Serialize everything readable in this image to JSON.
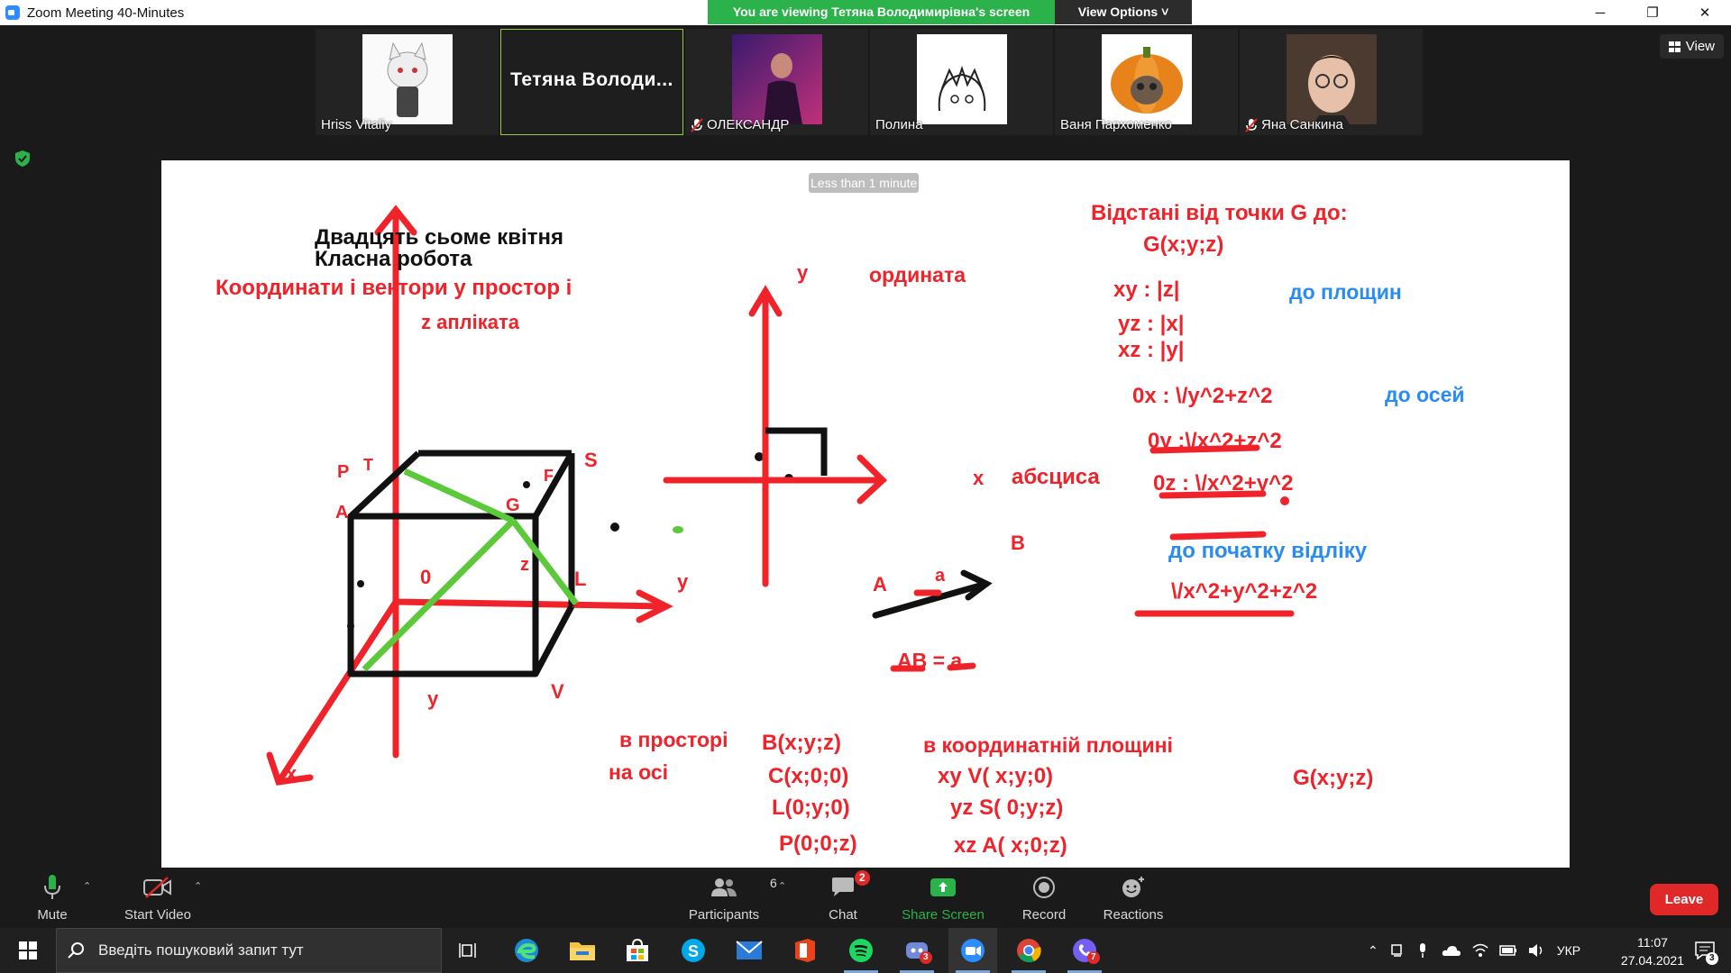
{
  "window": {
    "title": "Zoom Meeting 40-Minutes",
    "minimize_label": "─",
    "restore_label": "❐",
    "close_label": "✕"
  },
  "share_banner": {
    "message": "You are viewing Тетяна Володимирівна's screen",
    "view_options": "View Options ˅"
  },
  "gallery": {
    "participants": [
      {
        "name": "Hriss Vitaliy",
        "muted": false,
        "avatar": "white-cat-character"
      },
      {
        "name": "Тетяна  Володи...",
        "muted": false,
        "active": true
      },
      {
        "name": "ОЛЕКСАНДР",
        "muted": true,
        "avatar": "singer-photo"
      },
      {
        "name": "Полина",
        "muted": false,
        "avatar": "anime-sketch"
      },
      {
        "name": "Ваня Пархоменко",
        "muted": false,
        "avatar": "pumpkin-cat"
      },
      {
        "name": "Яна Санкина",
        "muted": true,
        "avatar": "boy-with-glasses"
      }
    ],
    "view_button": "View"
  },
  "whiteboard": {
    "timer_badge": "Less than 1 minute",
    "date_line": "Двадцять сьоме квітня",
    "class_line": "Класна робота",
    "topic": "Координати і вектори у простор  і",
    "z_label": "z апліката",
    "cube_labels": {
      "P": "P",
      "T": "T",
      "S": "S",
      "F": "F",
      "A": "A",
      "G": "G",
      "zero": "0",
      "z": "z",
      "L": "L",
      "y_axis": "y",
      "y_bottom": "y",
      "V": "V",
      "x": "x"
    },
    "plane": {
      "y": "y",
      "ordinate": "ордината",
      "x": "x",
      "abscissa": "абсциса"
    },
    "vector": {
      "A": "A",
      "B": "B",
      "a": "a",
      "eq": "AB  = a"
    },
    "distances_title": "Відстані від  точки  G до:",
    "distances_point": "G(x;y;z)",
    "planes_label": "до площин",
    "plane_rows": [
      "xy  :   |z|",
      "yz  :   |x|",
      "xz  :   |y|"
    ],
    "axes_label": "до осей",
    "axis_rows": [
      "0x  : \\/y^2+z^2",
      "0y :\\/x^2+z^2",
      "0z  : \\/x^2+y^2"
    ],
    "origin_label": "до початку відліку",
    "origin_formula": "\\/x^2+y^2+z^2",
    "in_space": "в просторі",
    "on_axis": "на осі",
    "in_plane": "в координатній площині",
    "points_axis": [
      "B(x;y;z)",
      "C(x;0;0)",
      "L(0;y;0)",
      "P(0;0;z)"
    ],
    "points_plane": [
      "xy V(   x;y;0)",
      "yz S(   0;y;z)",
      "xz A(   x;0;z)"
    ],
    "g_point": "G(x;y;z)"
  },
  "controls": {
    "mute": "Mute",
    "start_video": "Start Video",
    "participants": "Participants",
    "participants_count": "6",
    "chat": "Chat",
    "chat_badge": "2",
    "share_screen": "Share Screen",
    "record": "Record",
    "reactions": "Reactions",
    "leave": "Leave"
  },
  "taskbar": {
    "search_placeholder": "Введіть пошуковий запит тут",
    "language": "УКР",
    "time": "11:07",
    "date": "27.04.2021",
    "notifications": "3",
    "discord_badge": "3",
    "viber_badge": "7"
  },
  "colors": {
    "zoom_green": "#2bb24a",
    "ink_red": "#f0222a",
    "ink_blue": "#2a8cf0",
    "ink_green": "#5cc93a",
    "leave_red": "#e02828"
  }
}
